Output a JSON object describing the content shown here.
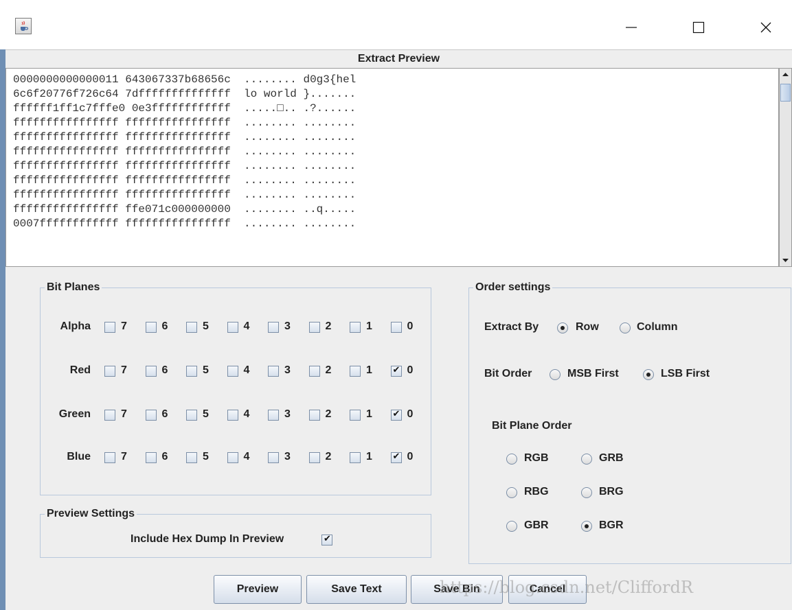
{
  "window": {
    "icon": "java-cup-icon",
    "controls": {
      "minimize": "—",
      "maximize": "☐",
      "close": "✕"
    }
  },
  "preview": {
    "title": "Extract Preview",
    "lines": [
      "0000000000000011 643067337b68656c  ........ d0g3{hel",
      "6c6f20776f726c64 7dffffffffffffff  lo world }.......",
      "ffffff1ff1c7fffe0 0e3ffffffffffff  .....□.. .?......",
      "ffffffffffffffff ffffffffffffffff  ........ ........",
      "ffffffffffffffff ffffffffffffffff  ........ ........",
      "ffffffffffffffff ffffffffffffffff  ........ ........",
      "ffffffffffffffff ffffffffffffffff  ........ ........",
      "ffffffffffffffff ffffffffffffffff  ........ ........",
      "ffffffffffffffff ffffffffffffffff  ........ ........",
      "ffffffffffffffff ffe071c000000000  ........ ..q.....",
      "0007ffffffffffff ffffffffffffffff  ........ ........"
    ]
  },
  "bit_planes": {
    "title": "Bit Planes",
    "bits": [
      "7",
      "6",
      "5",
      "4",
      "3",
      "2",
      "1",
      "0"
    ],
    "rows": [
      {
        "label": "Alpha",
        "checked": [
          false,
          false,
          false,
          false,
          false,
          false,
          false,
          false
        ]
      },
      {
        "label": "Red",
        "checked": [
          false,
          false,
          false,
          false,
          false,
          false,
          false,
          true
        ]
      },
      {
        "label": "Green",
        "checked": [
          false,
          false,
          false,
          false,
          false,
          false,
          false,
          true
        ]
      },
      {
        "label": "Blue",
        "checked": [
          false,
          false,
          false,
          false,
          false,
          false,
          false,
          true
        ]
      }
    ]
  },
  "preview_settings": {
    "title": "Preview Settings",
    "include_hex_label": "Include Hex Dump In Preview",
    "include_hex_checked": true
  },
  "order_settings": {
    "title": "Order settings",
    "extract_by_label": "Extract By",
    "extract_by_options": [
      "Row",
      "Column"
    ],
    "extract_by_selected": "Row",
    "bit_order_label": "Bit Order",
    "bit_order_options": [
      "MSB First",
      "LSB First"
    ],
    "bit_order_selected": "LSB First",
    "plane_order_label": "Bit Plane Order",
    "plane_order_options": [
      "RGB",
      "GRB",
      "RBG",
      "BRG",
      "GBR",
      "BGR"
    ],
    "plane_order_selected": "BGR"
  },
  "buttons": {
    "preview": "Preview",
    "save_text": "Save Text",
    "save_bin": "Save Bin",
    "cancel": "Cancel"
  },
  "watermark": "https://blog.csdn.net/CliffordR"
}
